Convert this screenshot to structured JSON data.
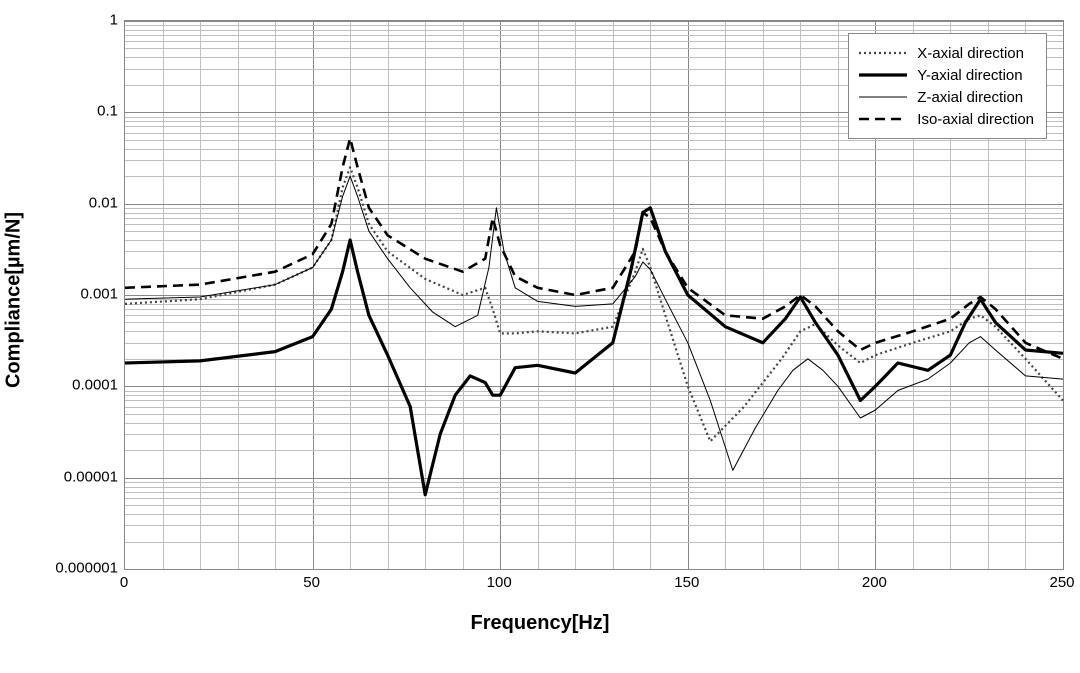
{
  "chart_data": {
    "type": "line",
    "xlabel": "Frequency[Hz]",
    "ylabel": "Compliance[µm/N]",
    "xlim": [
      0,
      250
    ],
    "ylim": [
      1e-06,
      1
    ],
    "yscale": "log",
    "x_ticks": [
      0,
      50,
      100,
      150,
      200,
      250
    ],
    "x_minor_step": 10,
    "y_ticks": [
      1,
      0.1,
      0.01,
      0.001,
      0.0001,
      1e-05,
      1e-06
    ],
    "y_tick_labels": [
      "1",
      "0.1",
      "0.01",
      "0.001",
      "0.0001",
      "0.00001",
      "0.000001"
    ],
    "legend_position": "top-right",
    "series": [
      {
        "name": "X-axial direction",
        "style": "dotted-thick",
        "x": [
          0,
          20,
          40,
          50,
          55,
          58,
          60,
          62,
          65,
          70,
          80,
          90,
          96,
          98,
          100,
          104,
          110,
          120,
          130,
          136,
          138,
          140,
          144,
          150,
          156,
          165,
          175,
          180,
          184,
          190,
          196,
          200,
          210,
          220,
          225,
          228,
          232,
          240,
          250
        ],
        "values": [
          0.0008,
          0.0009,
          0.0013,
          0.002,
          0.004,
          0.015,
          0.025,
          0.015,
          0.006,
          0.003,
          0.0015,
          0.001,
          0.0012,
          0.0007,
          0.00038,
          0.00038,
          0.0004,
          0.00038,
          0.00045,
          0.0018,
          0.0032,
          0.002,
          0.0006,
          0.0001,
          2.5e-05,
          6e-05,
          0.0002,
          0.0004,
          0.00048,
          0.00028,
          0.00018,
          0.00022,
          0.0003,
          0.0004,
          0.00055,
          0.0006,
          0.00045,
          0.0002,
          7e-05
        ]
      },
      {
        "name": "Y-axial direction",
        "style": "solid-heavy",
        "x": [
          0,
          20,
          40,
          50,
          55,
          58,
          60,
          62,
          65,
          70,
          76,
          80,
          84,
          88,
          92,
          96,
          98,
          100,
          104,
          110,
          120,
          130,
          135,
          138,
          140,
          144,
          150,
          160,
          170,
          176,
          180,
          184,
          190,
          196,
          200,
          206,
          214,
          220,
          224,
          228,
          232,
          240,
          250
        ],
        "values": [
          0.00018,
          0.00019,
          0.00024,
          0.00035,
          0.0007,
          0.0018,
          0.004,
          0.0018,
          0.0006,
          0.00022,
          6e-05,
          6.5e-06,
          3e-05,
          8e-05,
          0.00013,
          0.00011,
          8e-05,
          8e-05,
          0.00016,
          0.00017,
          0.00014,
          0.0003,
          0.002,
          0.008,
          0.009,
          0.003,
          0.001,
          0.00045,
          0.0003,
          0.00055,
          0.00095,
          0.0005,
          0.00022,
          7e-05,
          0.0001,
          0.00018,
          0.00015,
          0.00022,
          0.0005,
          0.0009,
          0.0005,
          0.00025,
          0.00023
        ]
      },
      {
        "name": "Z-axial direction",
        "style": "solid-thin",
        "x": [
          0,
          20,
          40,
          50,
          55,
          58,
          60,
          62,
          65,
          70,
          76,
          82,
          88,
          94,
          97,
          99,
          101,
          104,
          110,
          120,
          130,
          136,
          138,
          140,
          144,
          150,
          156,
          162,
          168,
          174,
          178,
          182,
          186,
          190,
          196,
          200,
          206,
          214,
          220,
          225,
          228,
          232,
          240,
          250
        ],
        "values": [
          0.0009,
          0.00095,
          0.0013,
          0.002,
          0.004,
          0.012,
          0.02,
          0.012,
          0.005,
          0.0025,
          0.0012,
          0.00065,
          0.00045,
          0.0006,
          0.002,
          0.009,
          0.003,
          0.0012,
          0.00085,
          0.00075,
          0.0008,
          0.0016,
          0.0023,
          0.0019,
          0.0009,
          0.0003,
          7e-05,
          1.2e-05,
          3.5e-05,
          9e-05,
          0.00015,
          0.0002,
          0.00015,
          0.0001,
          4.5e-05,
          5.5e-05,
          9e-05,
          0.00012,
          0.00018,
          0.0003,
          0.00035,
          0.00025,
          0.00013,
          0.00012
        ]
      },
      {
        "name": "Iso-axial direction",
        "style": "dashed-heavy",
        "x": [
          0,
          20,
          40,
          50,
          55,
          58,
          60,
          62,
          65,
          70,
          80,
          90,
          96,
          98,
          100,
          104,
          110,
          120,
          130,
          136,
          138,
          140,
          144,
          150,
          160,
          170,
          176,
          180,
          184,
          190,
          196,
          200,
          210,
          220,
          225,
          228,
          232,
          240,
          250
        ],
        "values": [
          0.0012,
          0.0013,
          0.0018,
          0.0028,
          0.006,
          0.025,
          0.052,
          0.025,
          0.009,
          0.0045,
          0.0025,
          0.0018,
          0.0025,
          0.007,
          0.0035,
          0.0016,
          0.0012,
          0.001,
          0.0012,
          0.003,
          0.008,
          0.007,
          0.003,
          0.0012,
          0.0006,
          0.00055,
          0.00075,
          0.001,
          0.00075,
          0.0004,
          0.00025,
          0.0003,
          0.0004,
          0.00055,
          0.0008,
          0.00095,
          0.0007,
          0.0003,
          0.0002
        ]
      }
    ]
  }
}
